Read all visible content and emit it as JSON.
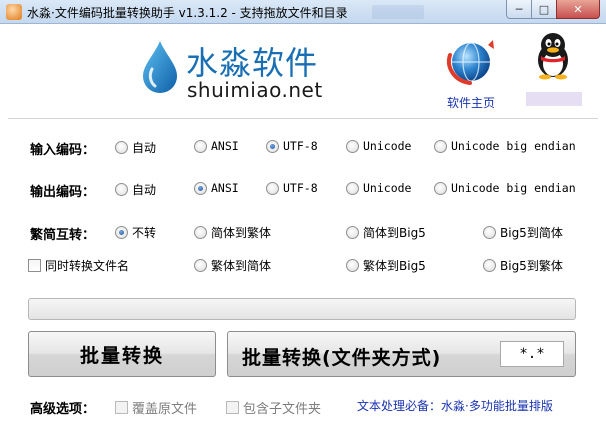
{
  "window": {
    "title": "水淼·文件编码批量转换助手 v1.3.1.2 - 支持拖放文件和目录",
    "minimize_glyph": "─",
    "maximize_glyph": "□",
    "close_glyph": "✕"
  },
  "brand": {
    "name_cn": "水淼软件",
    "name_en": "shuimiao.net",
    "home_link": "软件主页",
    "logo_icon": "water-drop-icon",
    "globe_icon": "globe-icon",
    "qq_icon": "qq-penguin-icon"
  },
  "input_encoding": {
    "label": "输入编码：",
    "options": [
      "自动",
      "ANSI",
      "UTF-8",
      "Unicode",
      "Unicode big endian"
    ],
    "selected": "UTF-8"
  },
  "output_encoding": {
    "label": "输出编码：",
    "options": [
      "自动",
      "ANSI",
      "UTF-8",
      "Unicode",
      "Unicode big endian"
    ],
    "selected": "ANSI"
  },
  "conversion": {
    "label": "繁简互转：",
    "options_row1": [
      "不转",
      "简体到繁体",
      "简体到Big5",
      "Big5到简体"
    ],
    "options_row2": [
      "繁体到简体",
      "繁体到Big5",
      "Big5到繁体"
    ],
    "selected": "不转",
    "rename_checkbox": "同时转换文件名"
  },
  "progress": {
    "value": 0
  },
  "actions": {
    "batch_convert": "批量转换",
    "batch_convert_folder": "批量转换(文件夹方式)",
    "pattern_value": "*.*"
  },
  "advanced": {
    "label": "高级选项：",
    "overwrite": "覆盖原文件",
    "include_subfolders": "包含子文件夹"
  },
  "promo_link": "文本处理必备：水淼·多功能批量排版",
  "colors": {
    "brand_blue": "#1a6fb4",
    "link_blue": "#1a33b0",
    "progress_green": "#6fbf3c"
  }
}
